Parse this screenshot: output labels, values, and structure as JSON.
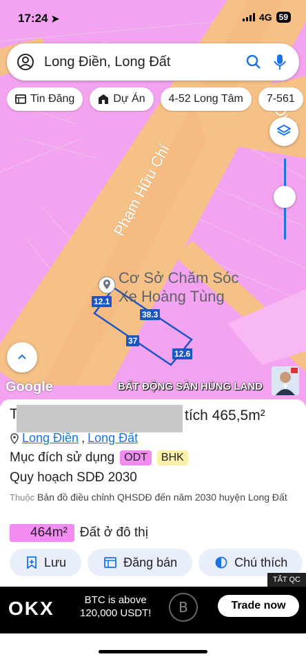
{
  "status": {
    "time": "17:24",
    "network": "4G",
    "battery": "59"
  },
  "search": {
    "query": "Long Điền, Long Đất"
  },
  "chips": [
    "Tin Đăng",
    "Dự Án",
    "4-52 Long Tâm",
    "7-561"
  ],
  "map": {
    "street1": "Phạm Hữu Chí",
    "street2": "Đườ",
    "poi": "Cơ Sở Chăm Sóc Xe Hoàng Tùng",
    "dims": [
      "12.1",
      "38.3",
      "37",
      "12.6"
    ],
    "google": "Google",
    "watermark": "BẤT ĐỘNG SẢN HÙNG LAND"
  },
  "sheet": {
    "title_prefix": "T",
    "title_suffix": "tích 465,5m²",
    "loc1": "Long Điền",
    "loc_sep": ",",
    "loc2": "Long Đất",
    "purpose_label": "Mục đích sử dụng",
    "tag1": "ODT",
    "tag2": "BHK",
    "plan_label": "Quy hoạch SDĐ 2030",
    "belongs_prefix": "Thuộc",
    "belongs_text": "Bản đồ điều chỉnh QHSDĐ đến năm 2030 huyện Long Đất",
    "area_value": "464m²",
    "area_desc": "Đất ở đô thị"
  },
  "actions": [
    "Lưu",
    "Đăng bán",
    "Chú thích"
  ],
  "ad": {
    "brand": "OKX",
    "text1": "BTC is above",
    "text2": "120,000 USDT!",
    "cta": "Trade now",
    "badge": "TẮT QC"
  },
  "colors": {
    "map_pink": "#f4a3f0",
    "road": "#f6c187",
    "accent": "#1a73e8",
    "parcel": "#1a56c4"
  }
}
